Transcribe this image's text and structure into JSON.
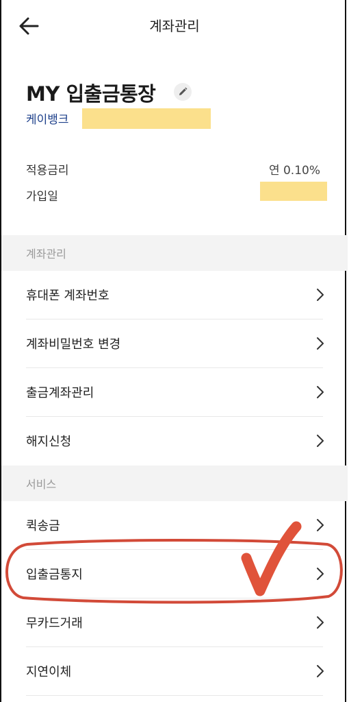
{
  "header": {
    "title": "계좌관리"
  },
  "account": {
    "name": "MY 입출금통장",
    "bank": "케이뱅크"
  },
  "info": [
    {
      "label": "적용금리",
      "value": "연 0.10%"
    },
    {
      "label": "가입일",
      "value": ""
    }
  ],
  "sections": [
    {
      "title": "계좌관리",
      "items": [
        {
          "label": "휴대폰 계좌번호"
        },
        {
          "label": "계좌비밀번호 변경"
        },
        {
          "label": "출금계좌관리"
        },
        {
          "label": "해지신청"
        }
      ]
    },
    {
      "title": "서비스",
      "items": [
        {
          "label": "퀵송금"
        },
        {
          "label": "입출금통지"
        },
        {
          "label": "무카드거래"
        },
        {
          "label": "지연이체"
        }
      ]
    }
  ],
  "colors": {
    "annotation": "#d24a38",
    "redaction": "#fbe08c",
    "bank_text": "#1c3f8a"
  },
  "icons": {
    "back": "arrow-left-icon",
    "edit": "pencil-icon",
    "row": "chevron-right-icon"
  }
}
